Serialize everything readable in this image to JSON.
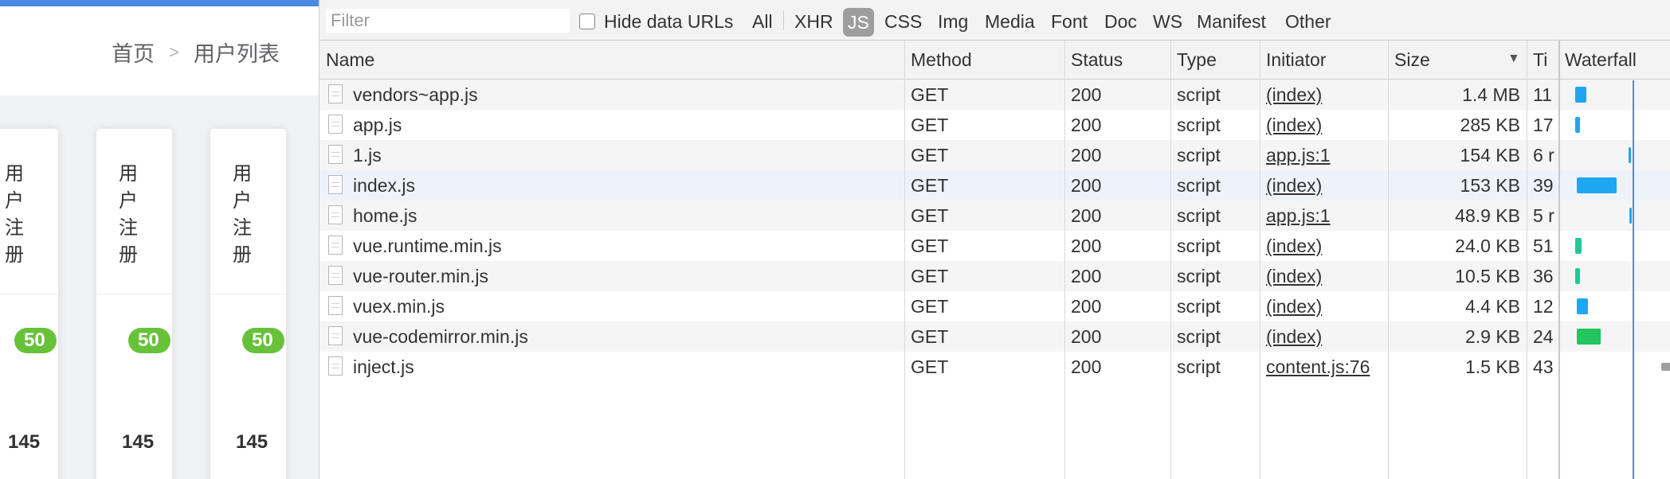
{
  "app": {
    "breadcrumb": [
      "首页",
      "用户列表"
    ],
    "breadcrumb_separator": ">",
    "cards": [
      {
        "title": "用户注册",
        "badge": "50",
        "value": "145"
      },
      {
        "title": "用户注册",
        "badge": "50",
        "value": "145"
      },
      {
        "title": "用户注册",
        "badge": "50",
        "value": "145"
      }
    ]
  },
  "devtools": {
    "filter_placeholder": "Filter",
    "hide_data_urls_label": "Hide data URLs",
    "hide_data_urls_checked": false,
    "type_filters": [
      "All",
      "XHR",
      "JS",
      "CSS",
      "Img",
      "Media",
      "Font",
      "Doc",
      "WS",
      "Manifest",
      "Other"
    ],
    "active_type_filter": "JS",
    "columns": {
      "name": "Name",
      "method": "Method",
      "status": "Status",
      "type": "Type",
      "initiator": "Initiator",
      "size": "Size",
      "time": "Ti",
      "waterfall": "Waterfall"
    },
    "rows": [
      {
        "name": "vendors~app.js",
        "method": "GET",
        "status": "200",
        "type": "script",
        "initiator": "(index)",
        "size": "1.4 MB",
        "time": "11",
        "bar_color": "#1ea7f0"
      },
      {
        "name": "app.js",
        "method": "GET",
        "status": "200",
        "type": "script",
        "initiator": "(index)",
        "size": "285 KB",
        "time": "17",
        "bar_color": "#1ea7f0"
      },
      {
        "name": "1.js",
        "method": "GET",
        "status": "200",
        "type": "script",
        "initiator": "app.js:1",
        "size": "154 KB",
        "time": "6 r",
        "bar_color": "#1ea7f0"
      },
      {
        "name": "index.js",
        "method": "GET",
        "status": "200",
        "type": "script",
        "initiator": "(index)",
        "size": "153 KB",
        "time": "39",
        "bar_color": "#1ea7f0"
      },
      {
        "name": "home.js",
        "method": "GET",
        "status": "200",
        "type": "script",
        "initiator": "app.js:1",
        "size": "48.9 KB",
        "time": "5 r",
        "bar_color": "#1ea7f0"
      },
      {
        "name": "vue.runtime.min.js",
        "method": "GET",
        "status": "200",
        "type": "script",
        "initiator": "(index)",
        "size": "24.0 KB",
        "time": "51",
        "bar_color": "#20c997"
      },
      {
        "name": "vue-router.min.js",
        "method": "GET",
        "status": "200",
        "type": "script",
        "initiator": "(index)",
        "size": "10.5 KB",
        "time": "36",
        "bar_color": "#20c997"
      },
      {
        "name": "vuex.min.js",
        "method": "GET",
        "status": "200",
        "type": "script",
        "initiator": "(index)",
        "size": "4.4 KB",
        "time": "12",
        "bar_color": "#1ea7f0"
      },
      {
        "name": "vue-codemirror.min.js",
        "method": "GET",
        "status": "200",
        "type": "script",
        "initiator": "(index)",
        "size": "2.9 KB",
        "time": "24",
        "bar_color": "#22c55e"
      },
      {
        "name": "inject.js",
        "method": "GET",
        "status": "200",
        "type": "script",
        "initiator": "content.js:76",
        "size": "1.5 KB",
        "time": "43",
        "bar_color": "#9e9e9e"
      }
    ],
    "colors": {
      "accent": "#4a8ae3",
      "selected_row": "#eef3fb",
      "badge": "#67c23a",
      "waterfall_line": "#4a90d9"
    }
  }
}
